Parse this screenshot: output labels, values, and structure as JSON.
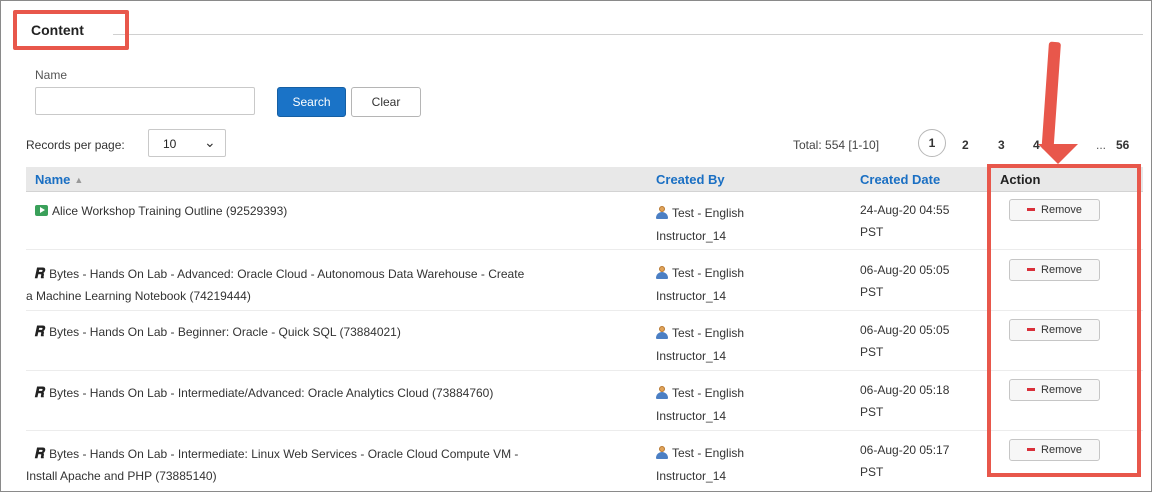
{
  "section": {
    "title": "Content"
  },
  "search": {
    "name_label": "Name",
    "name_value": "",
    "search_label": "Search",
    "clear_label": "Clear"
  },
  "pagination": {
    "records_per_page_label": "Records per page:",
    "records_per_page_value": "10",
    "total_text": "Total: 554 [1-10]",
    "pages": [
      "1",
      "2",
      "3",
      "4",
      "...",
      "56"
    ]
  },
  "table": {
    "headers": {
      "name": "Name",
      "created_by": "Created By",
      "created_date": "Created Date",
      "action": "Action"
    },
    "rows": [
      {
        "icon": "video-icon",
        "name_line1": "Alice Workshop Training Outline (92529393)",
        "name_line2": "",
        "created_by_line1": "Test - English",
        "created_by_line2": "Instructor_14",
        "date_line1": "24-Aug-20 04:55",
        "date_line2": "PST",
        "action": "Remove"
      },
      {
        "icon": "bytes-icon",
        "name_line1": "Bytes - Hands On Lab - Advanced: Oracle Cloud - Autonomous Data Warehouse - Create",
        "name_line2": "a Machine Learning Notebook (74219444)",
        "created_by_line1": "Test - English",
        "created_by_line2": "Instructor_14",
        "date_line1": "06-Aug-20 05:05",
        "date_line2": "PST",
        "action": "Remove"
      },
      {
        "icon": "bytes-icon",
        "name_line1": "Bytes - Hands On Lab - Beginner: Oracle - Quick SQL (73884021)",
        "name_line2": "",
        "created_by_line1": "Test - English",
        "created_by_line2": "Instructor_14",
        "date_line1": "06-Aug-20 05:05",
        "date_line2": "PST",
        "action": "Remove"
      },
      {
        "icon": "bytes-icon",
        "name_line1": "Bytes - Hands On Lab - Intermediate/Advanced: Oracle Analytics Cloud (73884760)",
        "name_line2": "",
        "created_by_line1": "Test - English",
        "created_by_line2": "Instructor_14",
        "date_line1": "06-Aug-20 05:18",
        "date_line2": "PST",
        "action": "Remove"
      },
      {
        "icon": "bytes-icon",
        "name_line1": "Bytes - Hands On Lab - Intermediate: Linux Web Services - Oracle Cloud Compute VM -",
        "name_line2": "Install Apache and PHP (73885140)",
        "created_by_line1": "Test - English",
        "created_by_line2": "Instructor_14",
        "date_line1": "06-Aug-20 05:17",
        "date_line2": "PST",
        "action": "Remove"
      }
    ]
  },
  "colors": {
    "accent": "#1a73c7",
    "highlight": "#e8574b",
    "remove_dash": "#d9303a"
  }
}
